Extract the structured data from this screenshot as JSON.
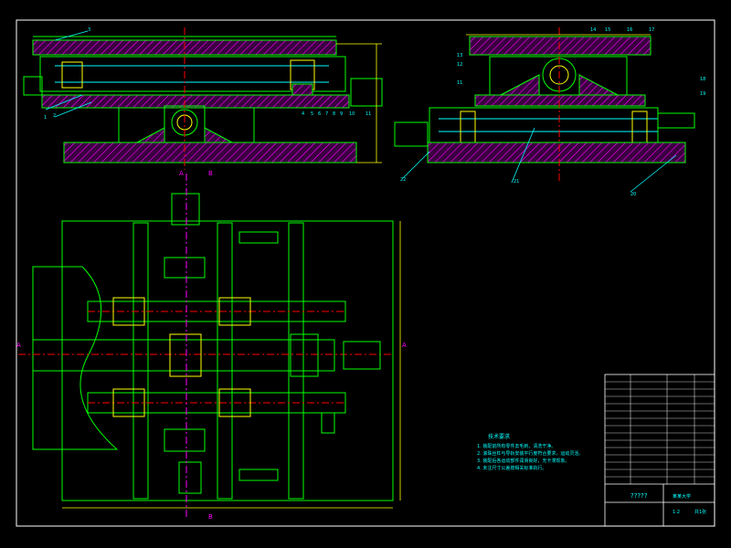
{
  "drawing": {
    "question_title": "?????",
    "section_markers": {
      "a": "A",
      "b": "B"
    },
    "top_view_labels": [
      "1",
      "2",
      "3",
      "4",
      "5",
      "6",
      "7",
      "8",
      "9",
      "10",
      "11"
    ],
    "side_view_labels": [
      "11",
      "12",
      "13",
      "14",
      "15",
      "16",
      "17",
      "18",
      "19",
      "20",
      "21",
      "22"
    ],
    "notes_title": "技术要求",
    "notes": [
      "1. 装配前所有零件去毛刺，清洗干净。",
      "2. 滚珠丝杠与导轨安装平行度符合要求，运动灵活。",
      "3. 装配后各运动部件润滑良好，无卡滞现象。",
      "4. 未注尺寸公差按相关标准执行。"
    ],
    "title_block": {
      "school": "某某大学",
      "drawing_name": "?????",
      "scale": "1:2",
      "sheet": "共1张"
    },
    "colors": {
      "frame": "#ffffff",
      "outline": "#00ff00",
      "hatch": "#ff00ff",
      "center": "#ff0000",
      "dimension": "#ffff00",
      "text": "#00ffff"
    }
  }
}
